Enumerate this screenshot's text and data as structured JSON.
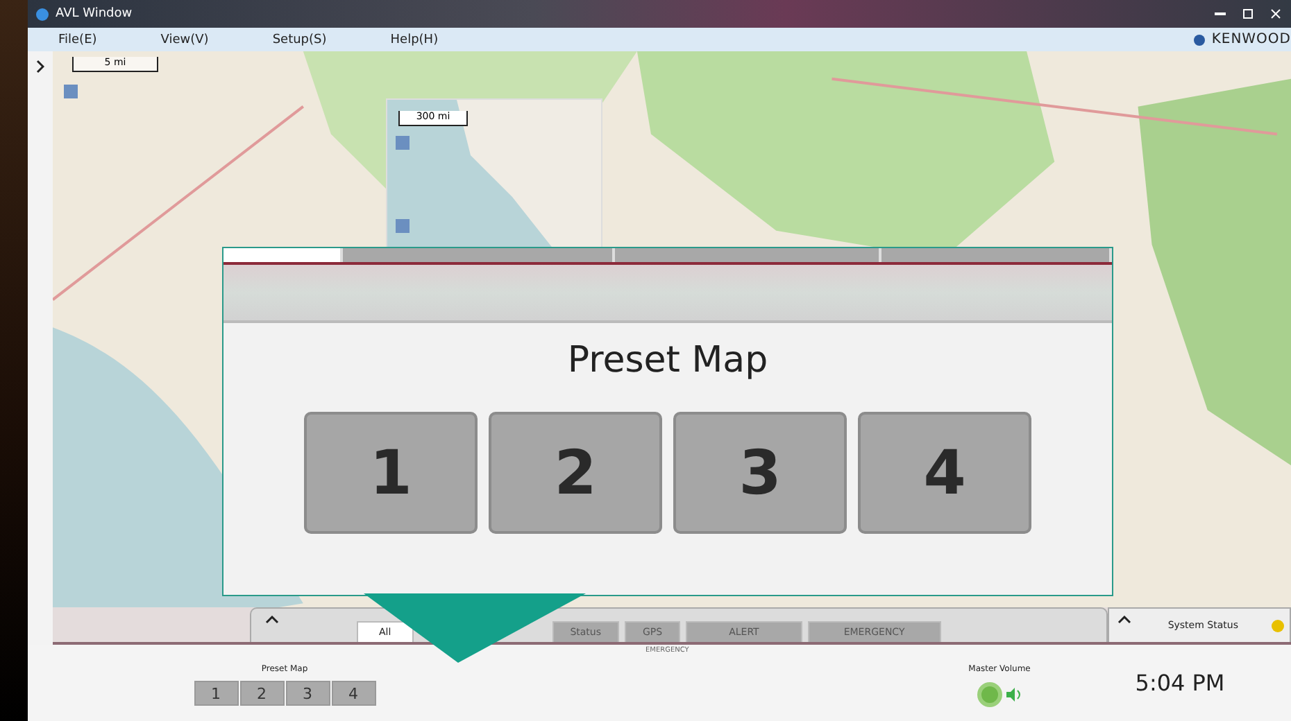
{
  "window": {
    "title": "AVL Window"
  },
  "menu": [
    {
      "label": "File(E)"
    },
    {
      "label": "View(V)"
    },
    {
      "label": "Setup(S)"
    },
    {
      "label": "Help(H)"
    }
  ],
  "brand": "KENWOOD",
  "map": {
    "scale": "5 mi",
    "inset_scale": "300 mi"
  },
  "callout": {
    "title": "Preset Map",
    "buttons": [
      "1",
      "2",
      "3",
      "4"
    ]
  },
  "tabs": [
    {
      "label": "All",
      "selected": true
    },
    {
      "label": "Status",
      "selected": false
    },
    {
      "label": "GPS",
      "selected": false
    },
    {
      "label": "ALERT",
      "selected": false
    },
    {
      "label": "EMERGENCY",
      "selected": false
    }
  ],
  "tab_caption": "EMERGENCY",
  "system_status": {
    "label": "System Status"
  },
  "preset_map": {
    "label": "Preset Map",
    "buttons": [
      "1",
      "2",
      "3",
      "4"
    ]
  },
  "master_volume": {
    "label": "Master Volume"
  },
  "clock": {
    "time": "5:04 PM"
  }
}
